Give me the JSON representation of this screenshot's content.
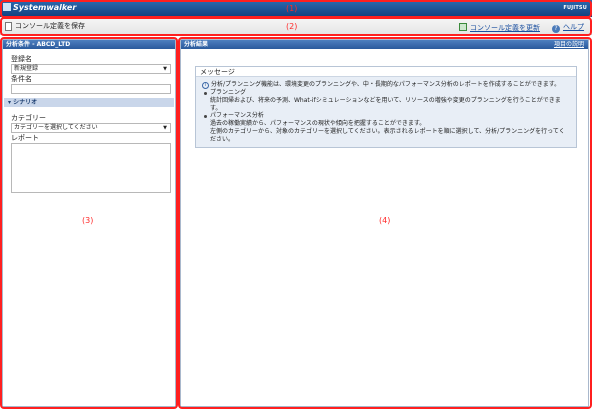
{
  "title_bar": {
    "product": "Systemwalker",
    "vendor": "FUJITSU",
    "annotation": "(1)"
  },
  "toolbar": {
    "save_label": "コンソール定義を保存",
    "refresh_label": "コンソール定義を更新",
    "help_label": "ヘルプ",
    "annotation": "(2)"
  },
  "left_panel": {
    "header": "分析条件 - ABCD_LTD",
    "registration_label": "登録名",
    "registration_value": "新規登録",
    "condition_label": "条件名",
    "scenario_label": "シナリオ",
    "category_label": "カテゴリー",
    "category_value": "カテゴリーを選択してください",
    "report_label": "レポート",
    "annotation": "(3)"
  },
  "right_panel": {
    "header": "分析結果",
    "item_link": "項目の説明",
    "message_title": "メッセージ",
    "intro": "分析/プランニング機能は、環境変更のプランニングや、中・長期的なパフォーマンス分析のレポートを作成することができます。",
    "planning_title": "プランニング",
    "planning_text": "統計回帰および、将来の予測、What-ifシミュレーションなどを用いて、リソースの増強や変更のプランニングを行うことができます。",
    "performance_title": "パフォーマンス分析",
    "performance_text": "過去の稼働実績から、パフォーマンスの現状や傾向を把握することができます。",
    "guidance": "左側のカテゴリーから、対象のカテゴリーを選択してください。表示されるレポートを順に選択して、分析/プランニングを行ってください。",
    "annotation": "(4)"
  },
  "colors": {
    "annotation_red": "#ff1f1f",
    "brand_blue": "#123f7d",
    "panel_header": "#2a5a9c"
  }
}
